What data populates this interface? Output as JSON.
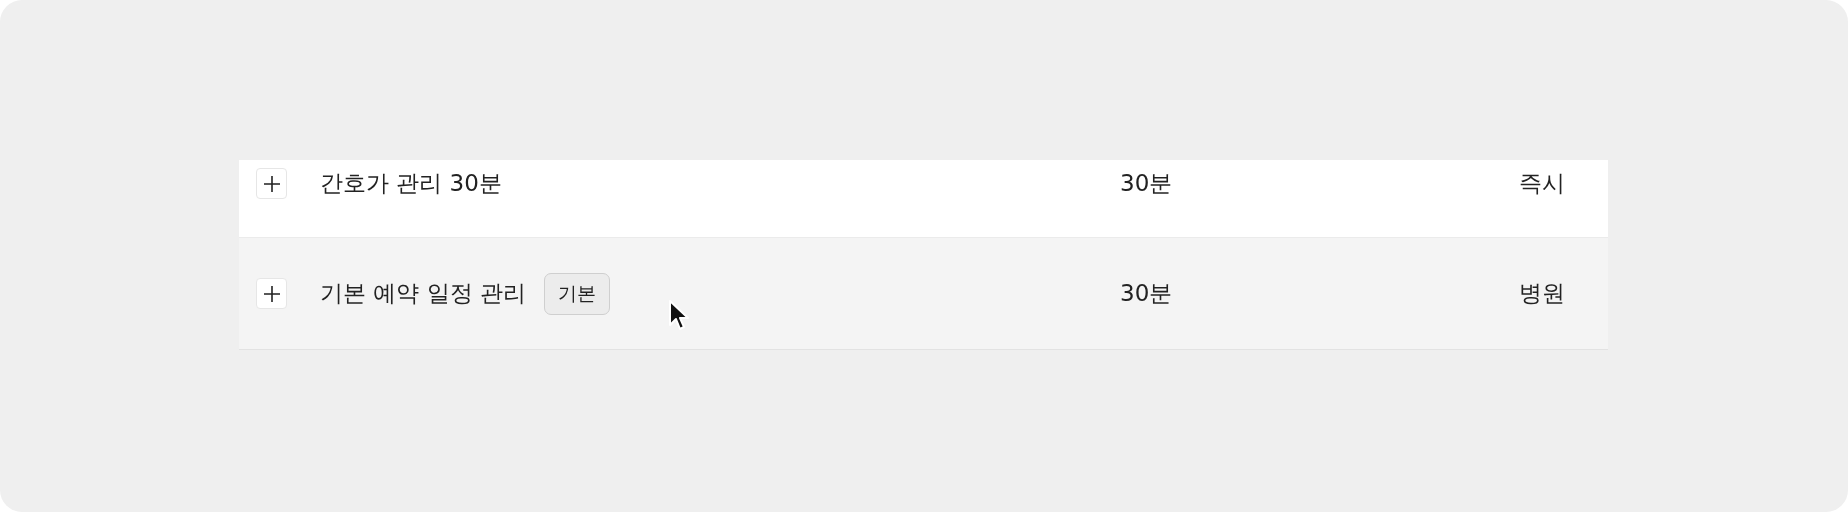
{
  "table": {
    "rows": [
      {
        "name": "간호가 관리 30분",
        "duration": "30분",
        "column_3": "즉시"
      },
      {
        "name": "기본 예약 일정 관리",
        "badge": "기본",
        "duration": "30분",
        "column_3": "병원"
      }
    ]
  }
}
